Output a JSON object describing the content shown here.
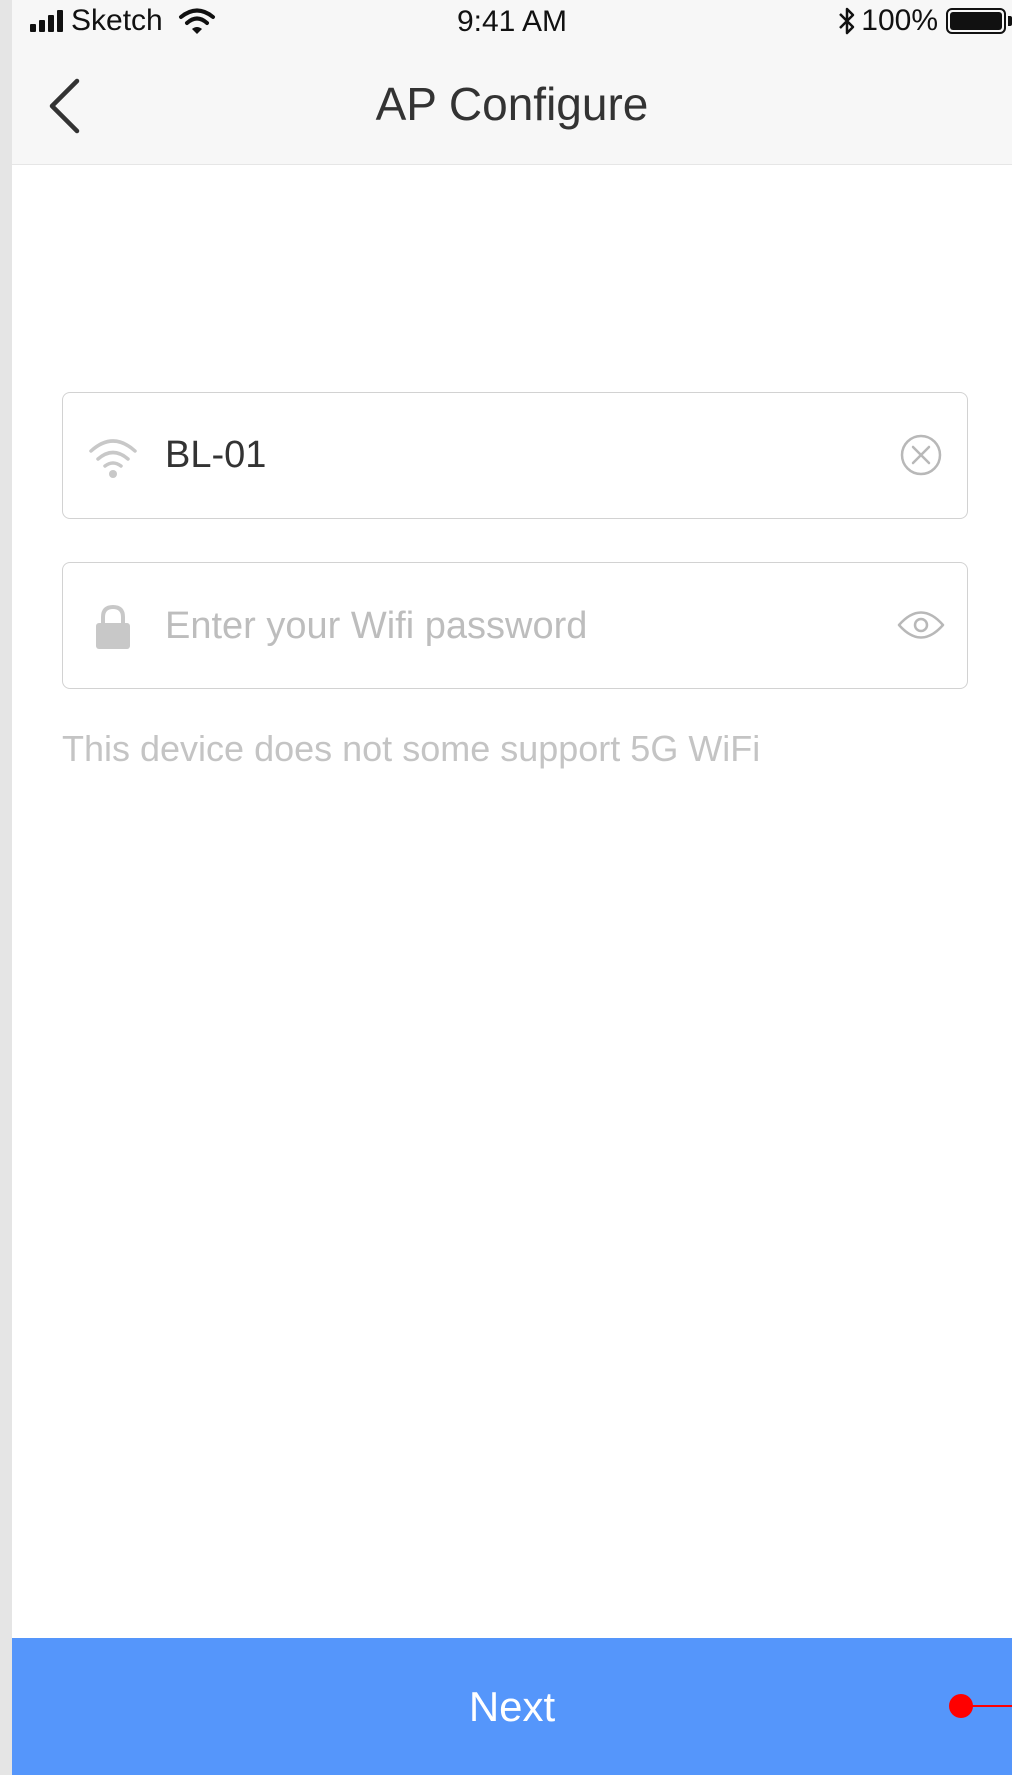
{
  "status_bar": {
    "carrier": "Sketch",
    "time": "9:41 AM",
    "battery_percent": "100%"
  },
  "nav": {
    "title": "AP Configure",
    "back_icon": "chevron-left-icon"
  },
  "ssid_field": {
    "icon": "wifi-icon",
    "value": "BL-01",
    "action_icon": "clear-circle-icon"
  },
  "password_field": {
    "icon": "lock-icon",
    "placeholder": "Enter your Wifi password",
    "value": "",
    "action_icon": "eye-icon"
  },
  "hint": "This device does not some support 5G WiFi",
  "next_button": {
    "label": "Next"
  },
  "colors": {
    "primary": "#5596fb",
    "marker": "#ff0000",
    "placeholder": "#bdbdbd"
  }
}
